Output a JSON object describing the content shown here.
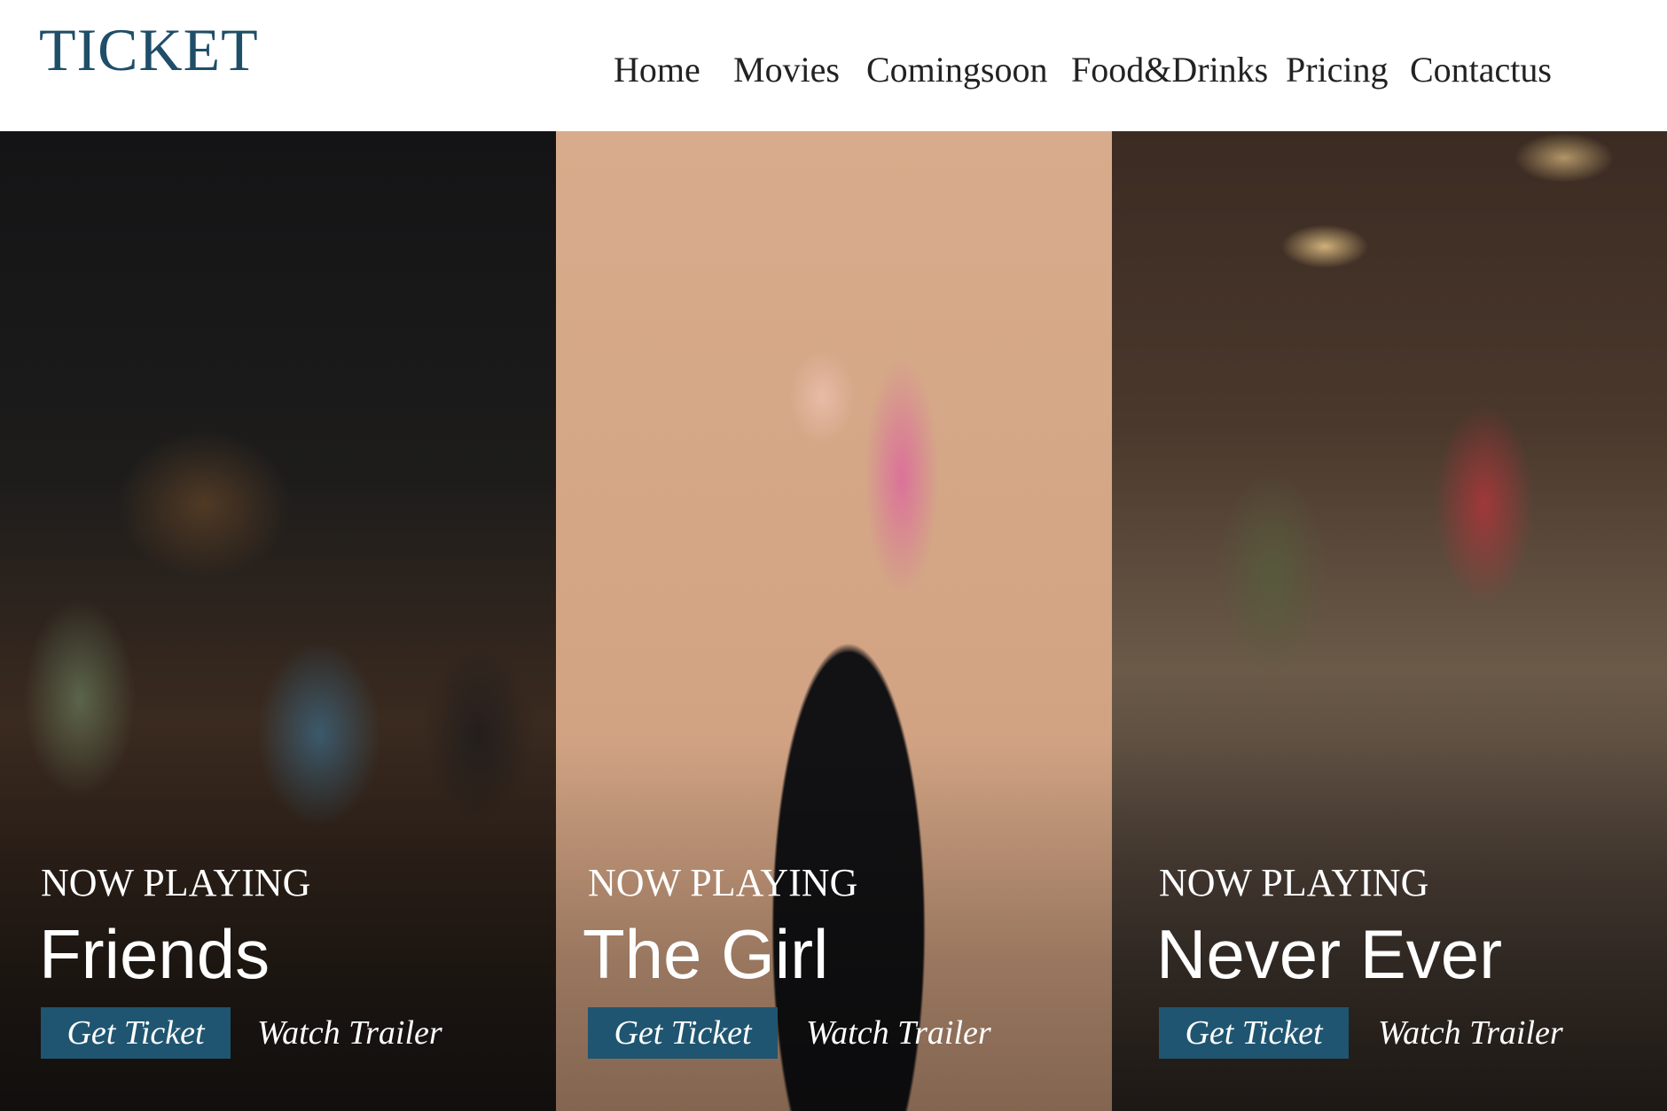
{
  "header": {
    "logo": "TICKET",
    "nav": [
      "Home",
      "Movies",
      "Comingsoon",
      "Food&Drinks",
      "Pricing",
      "Contactus"
    ]
  },
  "movies": [
    {
      "status": "NOW PLAYING",
      "title": "Friends",
      "cta": "Get Ticket",
      "trailer": "Watch Trailer"
    },
    {
      "status": "NOW PLAYING",
      "title": "The Girl",
      "cta": "Get Ticket",
      "trailer": "Watch Trailer"
    },
    {
      "status": "NOW PLAYING",
      "title": "Never Ever",
      "cta": "Get Ticket",
      "trailer": "Watch Trailer"
    }
  ]
}
